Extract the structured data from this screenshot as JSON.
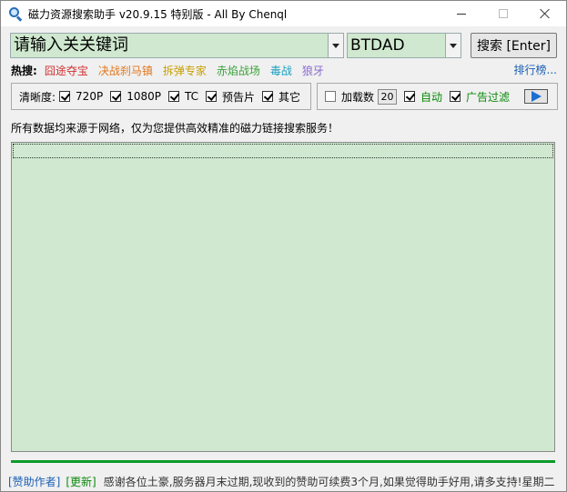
{
  "window": {
    "title": "磁力资源搜索助手 v20.9.15 特别版 - All By Chenql"
  },
  "search": {
    "keyword_placeholder": "请输入关关键词",
    "site_value": "BTDAD",
    "search_button": "搜索 [Enter]"
  },
  "hot": {
    "label": "热搜:",
    "items": [
      {
        "label": "囧途夺宝",
        "color": "#d03030"
      },
      {
        "label": "决战刹马镇",
        "color": "#e07820"
      },
      {
        "label": "拆弹专家",
        "color": "#c8a000"
      },
      {
        "label": "赤焰战场",
        "color": "#3aa33a"
      },
      {
        "label": "毒战",
        "color": "#1aa0c0"
      },
      {
        "label": "狼牙",
        "color": "#8a6ad0"
      }
    ],
    "rank_link": "排行榜..."
  },
  "options": {
    "clarity_label": "清晰度:",
    "clarity_items": [
      {
        "label": "720P",
        "checked": true
      },
      {
        "label": "1080P",
        "checked": true
      },
      {
        "label": "TC",
        "checked": true
      },
      {
        "label": "预告片",
        "checked": true
      },
      {
        "label": "其它",
        "checked": true
      }
    ],
    "load_count_label": "加载数",
    "load_count_checked": false,
    "load_count_value": "20",
    "auto_label": "自动",
    "auto_checked": true,
    "ad_filter_label": "广告过滤",
    "ad_filter_checked": true
  },
  "notice": "所有数据均来源于网络，仅为您提供高效精准的磁力链接搜索服务！",
  "progress": 1.0,
  "status": {
    "sponsor_link": "[赞助作者]",
    "update_link": "[更新]",
    "message": "感谢各位土豪,服务器月末过期,现收到的赞助可续费3个月,如果觉得助手好用,请多支持!星期二"
  },
  "colors": {
    "field_bg": "#cfe8cf",
    "accent_green": "#0a8a0a",
    "link_blue": "#1a5fb4"
  }
}
